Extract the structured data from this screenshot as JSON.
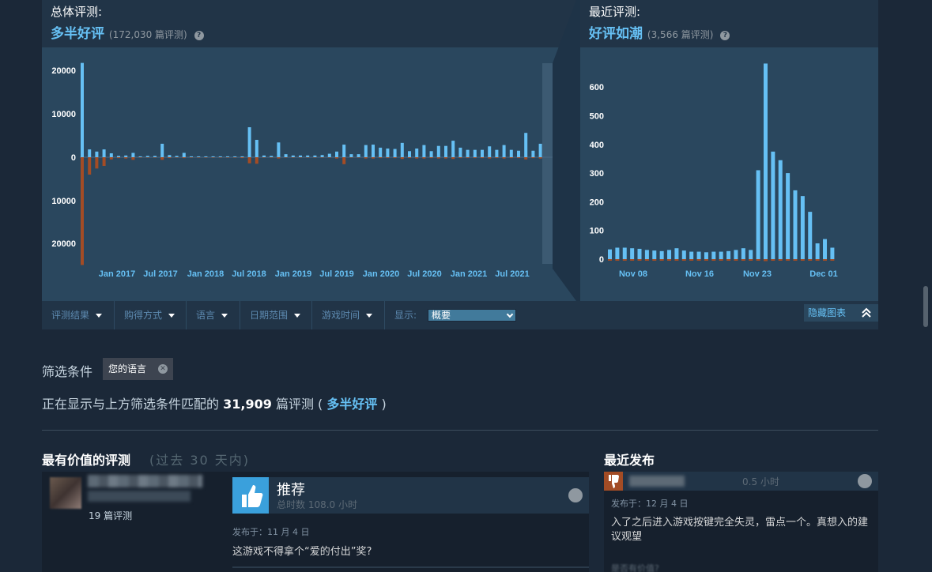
{
  "overall": {
    "label": "总体评测:",
    "summary": "多半好评",
    "count": "(172,030 篇评测)"
  },
  "recent": {
    "label": "最近评测:",
    "summary": "好评如潮",
    "count": "(3,566 篇评测)"
  },
  "filters": {
    "items": [
      "评测结果",
      "购得方式",
      "语言",
      "日期范围",
      "游戏时间"
    ],
    "show_label": "显示:",
    "show_value": "概要",
    "hide_chart": "隐藏图表"
  },
  "active_filters": {
    "label": "筛选条件",
    "chip": "您的语言"
  },
  "summary_line": {
    "prefix": "正在显示与上方筛选条件匹配的",
    "count": "31,909",
    "middle": "篇评测 (",
    "rating": "多半好评",
    "suffix": ")"
  },
  "sections": {
    "helpful_title": "最有价值的评测",
    "helpful_sub": "(过去 30 天内)",
    "recent_title": "最近发布"
  },
  "review_main": {
    "review_count": "19 篇评测",
    "vote": "推荐",
    "hours": "总时数 108.0 小时",
    "posted": "发布于：11 月 4 日",
    "text": "这游戏不得拿个“爱的付出”奖?"
  },
  "review_recent": {
    "hours": "0.5 小时",
    "posted": "发布于：12 月 4 日",
    "text": "入了之后进入游戏按键完全失灵，雷点一个。真想入的建议观望",
    "helpful": "是否有价值?"
  },
  "colors": {
    "positive": "#66c0f4",
    "negative": "#a34c25",
    "panel": "#2a475e",
    "panel_header": "#213447"
  },
  "chart_data": [
    {
      "type": "bar",
      "title": "",
      "y_ticks": [
        "20000",
        "10000",
        "0",
        "10000",
        "20000"
      ],
      "ylim": [
        -25000,
        22000
      ],
      "x_labels": [
        "Jan 2017",
        "Jul 2017",
        "Jan 2018",
        "Jul 2018",
        "Jan 2019",
        "Jul 2019",
        "Jan 2020",
        "Jul 2020",
        "Jan 2021",
        "Jul 2021"
      ],
      "positive": [
        21700,
        1800,
        1300,
        1800,
        900,
        300,
        400,
        1000,
        200,
        300,
        300,
        3100,
        500,
        300,
        1000,
        200,
        200,
        200,
        200,
        200,
        200,
        200,
        200,
        6900,
        4000,
        400,
        300,
        3400,
        700,
        400,
        400,
        400,
        400,
        500,
        800,
        1300,
        2900,
        700,
        700,
        2800,
        2900,
        2200,
        2000,
        1900,
        3300,
        1400,
        2000,
        2800,
        1400,
        2600,
        2600,
        3800,
        2200,
        1700,
        1700,
        1700,
        2500,
        1700,
        2800,
        1700,
        1500,
        5600,
        1500,
        3100
      ],
      "negative": [
        24800,
        4000,
        2600,
        2000,
        500,
        200,
        300,
        600,
        100,
        100,
        100,
        600,
        200,
        100,
        200,
        100,
        100,
        100,
        100,
        100,
        100,
        100,
        200,
        1400,
        1500,
        100,
        100,
        300,
        100,
        100,
        100,
        100,
        100,
        100,
        100,
        300,
        1600,
        100,
        100,
        300,
        300,
        200,
        200,
        200,
        400,
        200,
        300,
        300,
        200,
        300,
        300,
        400,
        200,
        200,
        200,
        200,
        300,
        200,
        300,
        200,
        200,
        500,
        200,
        300
      ]
    },
    {
      "type": "bar",
      "title": "",
      "y_ticks": [
        "600",
        "500",
        "400",
        "300",
        "200",
        "100",
        "0"
      ],
      "ylim": [
        0,
        700
      ],
      "x_labels": [
        "Nov 08",
        "Nov 16",
        "Nov 23",
        "Dec 01"
      ],
      "positive": [
        34,
        40,
        40,
        38,
        36,
        32,
        30,
        28,
        32,
        38,
        30,
        26,
        26,
        24,
        26,
        26,
        28,
        32,
        38,
        32,
        310,
        682,
        375,
        345,
        300,
        240,
        220,
        165,
        55,
        70,
        40
      ],
      "negative": [
        3,
        4,
        3,
        3,
        3,
        4,
        3,
        3,
        3,
        4,
        3,
        3,
        3,
        3,
        3,
        3,
        3,
        3,
        4,
        3,
        8,
        10,
        8,
        6,
        6,
        6,
        5,
        4,
        3,
        3,
        2
      ]
    }
  ]
}
